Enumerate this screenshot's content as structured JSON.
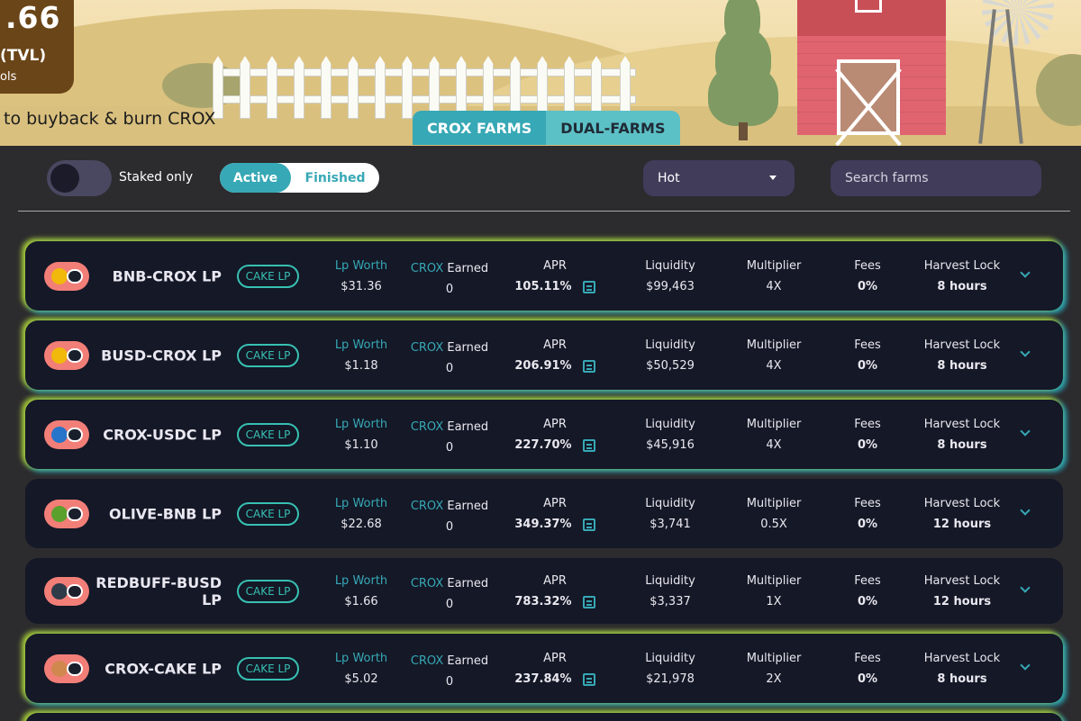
{
  "hero": {
    "tvl_value": ".66",
    "tvl_label": "(TVL)",
    "tvl_sub": "ols",
    "tagline": "to buyback & burn CROX",
    "tabs": [
      "CROX FARMS",
      "DUAL-FARMS"
    ]
  },
  "filters": {
    "staked_only_label": "Staked only",
    "status_options": [
      "Active",
      "Finished"
    ],
    "sort_value": "Hot",
    "search_placeholder": "Search farms"
  },
  "farm_headers": {
    "lp_worth": "Lp Worth",
    "earned_token": "CROX",
    "earned": "Earned",
    "apr": "APR",
    "liquidity": "Liquidity",
    "multiplier": "Multiplier",
    "fees": "Fees",
    "harvest_lock": "Harvest Lock"
  },
  "farms": [
    {
      "name": "BNB-CROX LP",
      "badge": "CAKE LP",
      "lp_worth": "$31.36",
      "earned": "0",
      "apr": "105.11%",
      "liquidity": "$99,463",
      "multiplier": "4X",
      "fees": "0%",
      "harvest_lock": "8 hours",
      "token_color": "#f0b90b"
    },
    {
      "name": "BUSD-CROX LP",
      "badge": "CAKE LP",
      "lp_worth": "$1.18",
      "earned": "0",
      "apr": "206.91%",
      "liquidity": "$50,529",
      "multiplier": "4X",
      "fees": "0%",
      "harvest_lock": "8 hours",
      "token_color": "#f0b90b"
    },
    {
      "name": "CROX-USDC LP",
      "badge": "CAKE LP",
      "lp_worth": "$1.10",
      "earned": "0",
      "apr": "227.70%",
      "liquidity": "$45,916",
      "multiplier": "4X",
      "fees": "0%",
      "harvest_lock": "8 hours",
      "token_color": "#2775ca"
    },
    {
      "name": "OLIVE-BNB LP",
      "badge": "CAKE LP",
      "lp_worth": "$22.68",
      "earned": "0",
      "apr": "349.37%",
      "liquidity": "$3,741",
      "multiplier": "0.5X",
      "fees": "0%",
      "harvest_lock": "12 hours",
      "token_color": "#5aa02c"
    },
    {
      "name": "REDBUFF-BUSD LP",
      "badge": "CAKE LP",
      "lp_worth": "$1.66",
      "earned": "0",
      "apr": "783.32%",
      "liquidity": "$3,337",
      "multiplier": "1X",
      "fees": "0%",
      "harvest_lock": "12 hours",
      "token_color": "#2f3b48"
    },
    {
      "name": "CROX-CAKE LP",
      "badge": "CAKE LP",
      "lp_worth": "$5.02",
      "earned": "0",
      "apr": "237.84%",
      "liquidity": "$21,978",
      "multiplier": "2X",
      "fees": "0%",
      "harvest_lock": "8 hours",
      "token_color": "#d1884f"
    }
  ]
}
